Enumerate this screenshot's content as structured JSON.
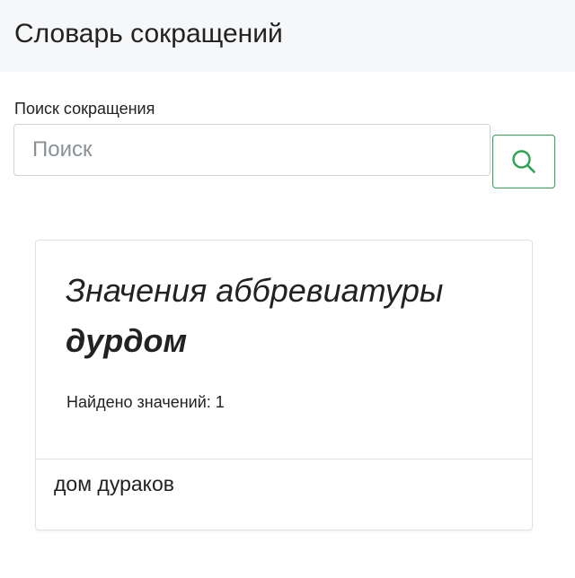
{
  "header": {
    "title": "Словарь сокращений"
  },
  "search": {
    "label": "Поиск сокращения",
    "placeholder": "Поиск",
    "value": "",
    "button_icon": "search-icon",
    "button_color": "#2ea44f"
  },
  "result": {
    "heading_prefix": "Значения аббревиатуры",
    "abbreviation": "дурдом",
    "count_label": "Найдено значений:",
    "count": "1",
    "meanings": [
      "дом дураков"
    ]
  }
}
